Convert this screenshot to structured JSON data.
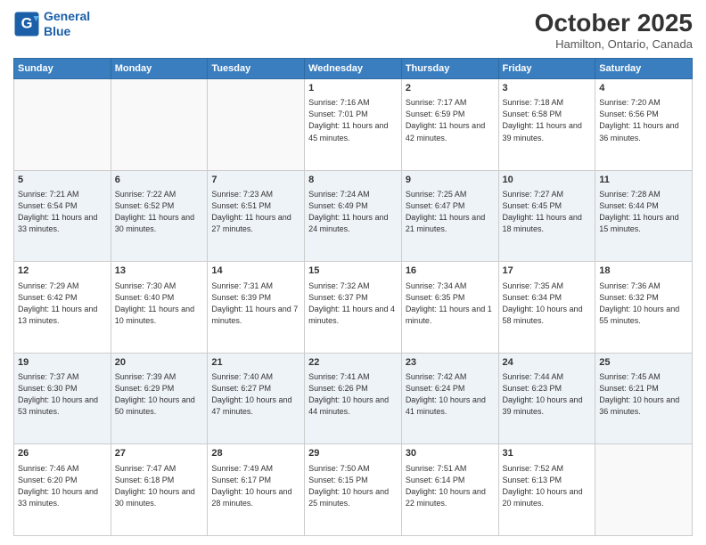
{
  "header": {
    "logo_line1": "General",
    "logo_line2": "Blue",
    "month": "October 2025",
    "location": "Hamilton, Ontario, Canada"
  },
  "weekdays": [
    "Sunday",
    "Monday",
    "Tuesday",
    "Wednesday",
    "Thursday",
    "Friday",
    "Saturday"
  ],
  "weeks": [
    [
      {
        "day": "",
        "sunrise": "",
        "sunset": "",
        "daylight": ""
      },
      {
        "day": "",
        "sunrise": "",
        "sunset": "",
        "daylight": ""
      },
      {
        "day": "",
        "sunrise": "",
        "sunset": "",
        "daylight": ""
      },
      {
        "day": "1",
        "sunrise": "Sunrise: 7:16 AM",
        "sunset": "Sunset: 7:01 PM",
        "daylight": "Daylight: 11 hours and 45 minutes."
      },
      {
        "day": "2",
        "sunrise": "Sunrise: 7:17 AM",
        "sunset": "Sunset: 6:59 PM",
        "daylight": "Daylight: 11 hours and 42 minutes."
      },
      {
        "day": "3",
        "sunrise": "Sunrise: 7:18 AM",
        "sunset": "Sunset: 6:58 PM",
        "daylight": "Daylight: 11 hours and 39 minutes."
      },
      {
        "day": "4",
        "sunrise": "Sunrise: 7:20 AM",
        "sunset": "Sunset: 6:56 PM",
        "daylight": "Daylight: 11 hours and 36 minutes."
      }
    ],
    [
      {
        "day": "5",
        "sunrise": "Sunrise: 7:21 AM",
        "sunset": "Sunset: 6:54 PM",
        "daylight": "Daylight: 11 hours and 33 minutes."
      },
      {
        "day": "6",
        "sunrise": "Sunrise: 7:22 AM",
        "sunset": "Sunset: 6:52 PM",
        "daylight": "Daylight: 11 hours and 30 minutes."
      },
      {
        "day": "7",
        "sunrise": "Sunrise: 7:23 AM",
        "sunset": "Sunset: 6:51 PM",
        "daylight": "Daylight: 11 hours and 27 minutes."
      },
      {
        "day": "8",
        "sunrise": "Sunrise: 7:24 AM",
        "sunset": "Sunset: 6:49 PM",
        "daylight": "Daylight: 11 hours and 24 minutes."
      },
      {
        "day": "9",
        "sunrise": "Sunrise: 7:25 AM",
        "sunset": "Sunset: 6:47 PM",
        "daylight": "Daylight: 11 hours and 21 minutes."
      },
      {
        "day": "10",
        "sunrise": "Sunrise: 7:27 AM",
        "sunset": "Sunset: 6:45 PM",
        "daylight": "Daylight: 11 hours and 18 minutes."
      },
      {
        "day": "11",
        "sunrise": "Sunrise: 7:28 AM",
        "sunset": "Sunset: 6:44 PM",
        "daylight": "Daylight: 11 hours and 15 minutes."
      }
    ],
    [
      {
        "day": "12",
        "sunrise": "Sunrise: 7:29 AM",
        "sunset": "Sunset: 6:42 PM",
        "daylight": "Daylight: 11 hours and 13 minutes."
      },
      {
        "day": "13",
        "sunrise": "Sunrise: 7:30 AM",
        "sunset": "Sunset: 6:40 PM",
        "daylight": "Daylight: 11 hours and 10 minutes."
      },
      {
        "day": "14",
        "sunrise": "Sunrise: 7:31 AM",
        "sunset": "Sunset: 6:39 PM",
        "daylight": "Daylight: 11 hours and 7 minutes."
      },
      {
        "day": "15",
        "sunrise": "Sunrise: 7:32 AM",
        "sunset": "Sunset: 6:37 PM",
        "daylight": "Daylight: 11 hours and 4 minutes."
      },
      {
        "day": "16",
        "sunrise": "Sunrise: 7:34 AM",
        "sunset": "Sunset: 6:35 PM",
        "daylight": "Daylight: 11 hours and 1 minute."
      },
      {
        "day": "17",
        "sunrise": "Sunrise: 7:35 AM",
        "sunset": "Sunset: 6:34 PM",
        "daylight": "Daylight: 10 hours and 58 minutes."
      },
      {
        "day": "18",
        "sunrise": "Sunrise: 7:36 AM",
        "sunset": "Sunset: 6:32 PM",
        "daylight": "Daylight: 10 hours and 55 minutes."
      }
    ],
    [
      {
        "day": "19",
        "sunrise": "Sunrise: 7:37 AM",
        "sunset": "Sunset: 6:30 PM",
        "daylight": "Daylight: 10 hours and 53 minutes."
      },
      {
        "day": "20",
        "sunrise": "Sunrise: 7:39 AM",
        "sunset": "Sunset: 6:29 PM",
        "daylight": "Daylight: 10 hours and 50 minutes."
      },
      {
        "day": "21",
        "sunrise": "Sunrise: 7:40 AM",
        "sunset": "Sunset: 6:27 PM",
        "daylight": "Daylight: 10 hours and 47 minutes."
      },
      {
        "day": "22",
        "sunrise": "Sunrise: 7:41 AM",
        "sunset": "Sunset: 6:26 PM",
        "daylight": "Daylight: 10 hours and 44 minutes."
      },
      {
        "day": "23",
        "sunrise": "Sunrise: 7:42 AM",
        "sunset": "Sunset: 6:24 PM",
        "daylight": "Daylight: 10 hours and 41 minutes."
      },
      {
        "day": "24",
        "sunrise": "Sunrise: 7:44 AM",
        "sunset": "Sunset: 6:23 PM",
        "daylight": "Daylight: 10 hours and 39 minutes."
      },
      {
        "day": "25",
        "sunrise": "Sunrise: 7:45 AM",
        "sunset": "Sunset: 6:21 PM",
        "daylight": "Daylight: 10 hours and 36 minutes."
      }
    ],
    [
      {
        "day": "26",
        "sunrise": "Sunrise: 7:46 AM",
        "sunset": "Sunset: 6:20 PM",
        "daylight": "Daylight: 10 hours and 33 minutes."
      },
      {
        "day": "27",
        "sunrise": "Sunrise: 7:47 AM",
        "sunset": "Sunset: 6:18 PM",
        "daylight": "Daylight: 10 hours and 30 minutes."
      },
      {
        "day": "28",
        "sunrise": "Sunrise: 7:49 AM",
        "sunset": "Sunset: 6:17 PM",
        "daylight": "Daylight: 10 hours and 28 minutes."
      },
      {
        "day": "29",
        "sunrise": "Sunrise: 7:50 AM",
        "sunset": "Sunset: 6:15 PM",
        "daylight": "Daylight: 10 hours and 25 minutes."
      },
      {
        "day": "30",
        "sunrise": "Sunrise: 7:51 AM",
        "sunset": "Sunset: 6:14 PM",
        "daylight": "Daylight: 10 hours and 22 minutes."
      },
      {
        "day": "31",
        "sunrise": "Sunrise: 7:52 AM",
        "sunset": "Sunset: 6:13 PM",
        "daylight": "Daylight: 10 hours and 20 minutes."
      },
      {
        "day": "",
        "sunrise": "",
        "sunset": "",
        "daylight": ""
      }
    ]
  ]
}
